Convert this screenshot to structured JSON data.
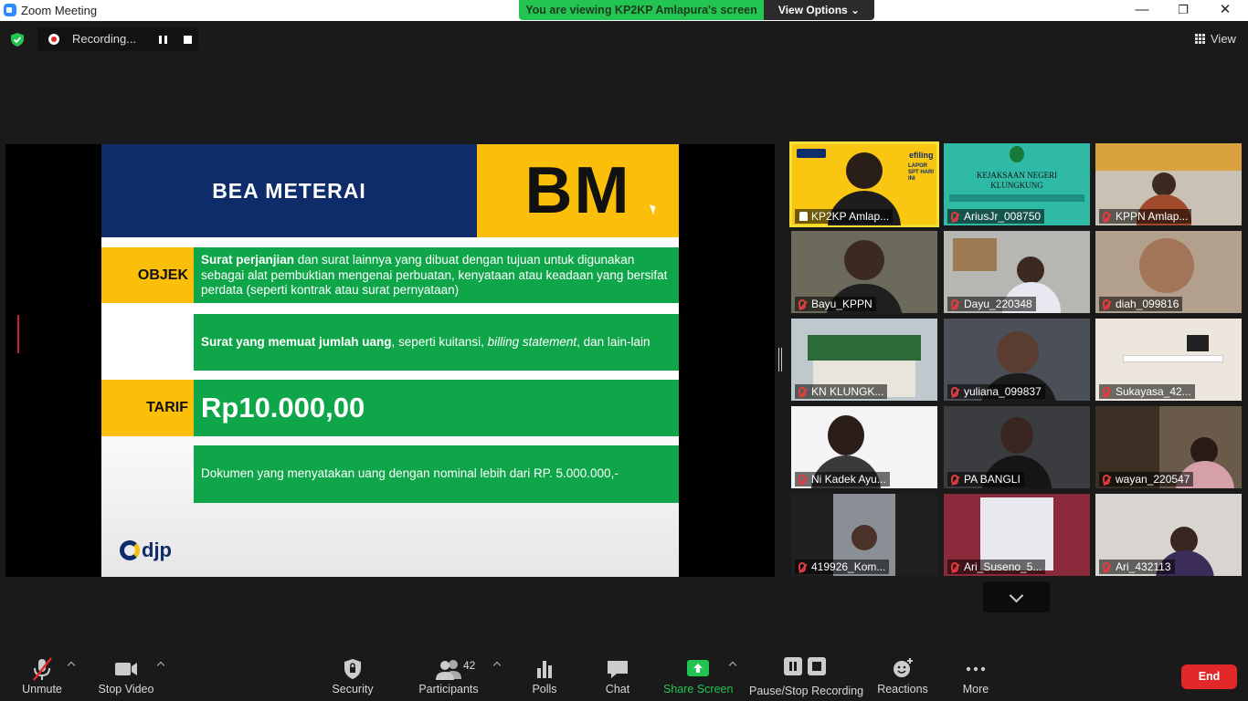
{
  "window": {
    "title": "Zoom Meeting",
    "minimize": "—",
    "restore": "❐",
    "close": "✕"
  },
  "banner": {
    "message": "You are viewing KP2KP Amlapura's screen",
    "options_label": "View Options ⌄"
  },
  "recording": {
    "label": "Recording..."
  },
  "view_button": {
    "label": "View"
  },
  "slide": {
    "title": "BEA METERAI",
    "logo": "BM",
    "objek_label": "OBJEK",
    "objek_bold": "Surat perjanjian",
    "objek_text": " dan surat lainnya yang dibuat dengan tujuan untuk digunakan sebagai alat pembuktian mengenai perbuatan, kenyataan atau keadaan yang bersifat perdata (seperti kontrak atau surat pernyataan)",
    "objek2_bold": "Surat yang memuat jumlah uang",
    "objek2_text": ", seperti kuitansi, ",
    "objek2_italic": "billing statement",
    "objek2_tail": ", dan lain-lain",
    "tarif_label": "TARIF",
    "tarif_amount": "Rp10.000,00",
    "tarif_note": "Dokumen yang menyatakan uang dengan nominal lebih dari RP. 5.000.000,-",
    "brand": "djp"
  },
  "gallery": [
    {
      "name": "KP2KP Amlap...",
      "speaker": true
    },
    {
      "name": "AriusJr_008750"
    },
    {
      "name": "KPPN Amlap..."
    },
    {
      "name": "Bayu_KPPN"
    },
    {
      "name": "Dayu_220348"
    },
    {
      "name": "diah_099816"
    },
    {
      "name": "KN KLUNGK..."
    },
    {
      "name": "yuliana_099837"
    },
    {
      "name": "Sukayasa_42..."
    },
    {
      "name": "Ni Kadek Ayu..."
    },
    {
      "name": "PA BANGLI"
    },
    {
      "name": "wayan_220547"
    },
    {
      "name": "419926_Kom..."
    },
    {
      "name": "Ari_Suseno_5..."
    },
    {
      "name": "Ari_432113"
    }
  ],
  "tile_texts": {
    "kejaksaan_line1": "KEJAKSAAN NEGERI",
    "kejaksaan_line2": "KLUNGKUNG",
    "efiling": "efiling",
    "lapor": "LAPOR SPT HARI INI"
  },
  "toolbar": {
    "unmute": "Unmute",
    "stop_video": "Stop Video",
    "security": "Security",
    "participants": "Participants",
    "participants_count": "42",
    "polls": "Polls",
    "chat": "Chat",
    "share_screen": "Share Screen",
    "pause_stop_recording": "Pause/Stop Recording",
    "reactions": "Reactions",
    "more": "More",
    "end": "End"
  },
  "colors": {
    "share_green": "#23c552",
    "end_red": "#e02828",
    "speaker_yellow": "#f5e135",
    "slide_navy": "#0e2c6a",
    "slide_gold": "#fbbf0a",
    "slide_green": "#0fa64a"
  }
}
